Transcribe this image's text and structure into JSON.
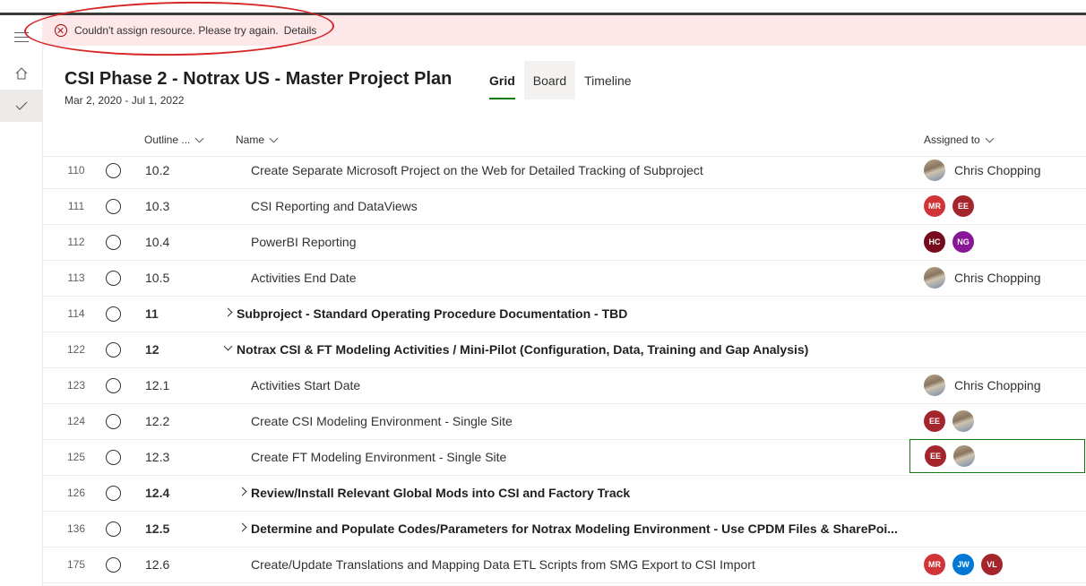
{
  "rail": {
    "menu_icon": "hamburger-icon",
    "home_icon": "home-icon",
    "tasks_icon": "checkmark-icon"
  },
  "banner": {
    "icon": "error-circle-icon",
    "message": "Couldn't assign resource. Please try again.",
    "details_link": "Details",
    "background": "#fde7e9"
  },
  "header": {
    "title": "CSI Phase 2 - Notrax US - Master Project Plan",
    "dates": "Mar 2, 2020 - Jul 1, 2022",
    "tabs": [
      {
        "label": "Grid",
        "active": true
      },
      {
        "label": "Board",
        "active": false
      },
      {
        "label": "Timeline",
        "active": false
      }
    ]
  },
  "columns": {
    "outline": "Outline ...",
    "name": "Name",
    "assigned": "Assigned to"
  },
  "colors": {
    "accent": "#107c10",
    "avatar_mr": "#d13438",
    "avatar_ee": "#a4262c",
    "avatar_hc": "#750b1c",
    "avatar_ng": "#881798",
    "avatar_jw": "#0078d4",
    "avatar_vl": "#a4262c"
  },
  "rows": [
    {
      "id": "110",
      "outline": "10.2",
      "name": "Create Separate Microsoft Project on the Web for Detailed Tracking of Subproject",
      "assigned_name": "Chris Chopping"
    },
    {
      "id": "111",
      "outline": "10.3",
      "name": "CSI Reporting and DataViews",
      "avatars": [
        "MR",
        "EE"
      ]
    },
    {
      "id": "112",
      "outline": "10.4",
      "name": "PowerBI Reporting",
      "avatars": [
        "HC",
        "NG"
      ]
    },
    {
      "id": "113",
      "outline": "10.5",
      "name": "Activities End Date",
      "assigned_name": "Chris Chopping"
    },
    {
      "id": "114",
      "outline": "11",
      "name": "Subproject - Standard Operating Procedure Documentation - TBD",
      "summary": true,
      "expander": "collapsed"
    },
    {
      "id": "122",
      "outline": "12",
      "name": "Notrax CSI & FT Modeling Activities / Mini-Pilot (Configuration, Data, Training and Gap Analysis)",
      "summary": true,
      "expander": "expanded"
    },
    {
      "id": "123",
      "outline": "12.1",
      "name": "Activities Start Date",
      "assigned_name": "Chris Chopping"
    },
    {
      "id": "124",
      "outline": "12.2",
      "name": "Create CSI Modeling Environment - Single Site",
      "avatars": [
        "EE"
      ],
      "photo": true
    },
    {
      "id": "125",
      "outline": "12.3",
      "name": "Create FT Modeling Environment - Single Site",
      "avatars": [
        "EE"
      ],
      "photo": true,
      "focused": true
    },
    {
      "id": "126",
      "outline": "12.4",
      "name": "Review/Install Relevant Global Mods into CSI and Factory Track",
      "summary": true,
      "expander": "collapsed"
    },
    {
      "id": "136",
      "outline": "12.5",
      "name": "Determine and Populate Codes/Parameters for Notrax Modeling Environment - Use CPDM Files & SharePoi...",
      "summary": true,
      "expander": "collapsed"
    },
    {
      "id": "175",
      "outline": "12.6",
      "name": "Create/Update Translations and Mapping Data ETL Scripts from SMG Export to CSI Import",
      "avatars": [
        "MR",
        "JW",
        "VL"
      ]
    }
  ]
}
